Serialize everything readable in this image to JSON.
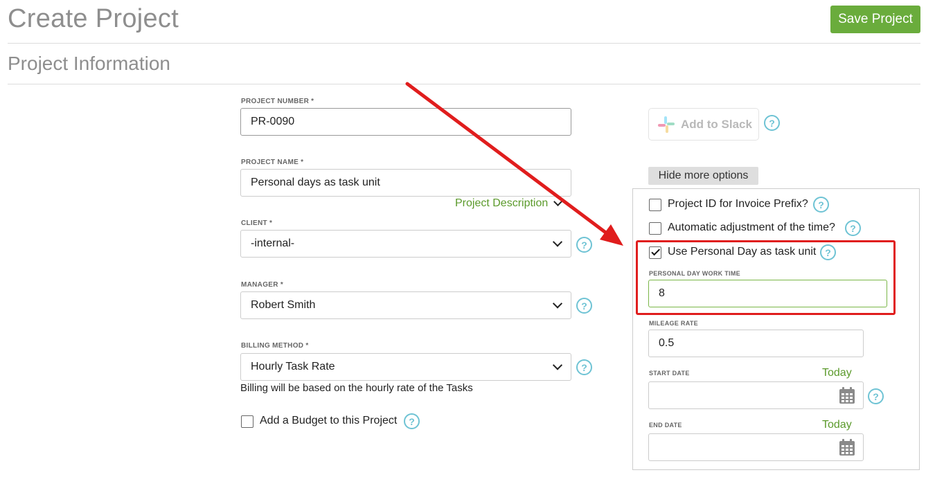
{
  "header": {
    "title": "Create Project",
    "save_label": "Save Project"
  },
  "section": {
    "title": "Project Information"
  },
  "form": {
    "project_number": {
      "label": "PROJECT NUMBER *",
      "value": "PR-0090"
    },
    "project_name": {
      "label": "PROJECT NAME *",
      "value": "Personal days as task unit"
    },
    "project_description_link": "Project Description",
    "client": {
      "label": "CLIENT *",
      "value": "-internal-"
    },
    "manager": {
      "label": "MANAGER *",
      "value": "Robert Smith"
    },
    "billing_method": {
      "label": "BILLING METHOD *",
      "value": "Hourly Task Rate",
      "help_text": "Billing will be based on the hourly rate of the Tasks"
    },
    "add_budget": {
      "label": "Add a Budget to this Project",
      "checked": false
    }
  },
  "sidebar": {
    "slack_label": "Add to Slack",
    "hide_options_label": "Hide more options",
    "options": {
      "invoice_prefix": {
        "label": "Project ID for Invoice Prefix?",
        "checked": false
      },
      "auto_adjust": {
        "label": "Automatic adjustment of the time?",
        "checked": false
      },
      "personal_day": {
        "label": "Use Personal Day as task unit",
        "checked": true
      },
      "personal_day_work_time": {
        "label": "PERSONAL DAY WORK TIME",
        "value": "8"
      },
      "mileage_rate": {
        "label": "MILEAGE RATE",
        "value": "0.5"
      },
      "start_date": {
        "label": "START DATE",
        "today_link": "Today",
        "value": ""
      },
      "end_date": {
        "label": "END DATE",
        "today_link": "Today",
        "value": ""
      }
    }
  },
  "help_glyph": "?",
  "colors": {
    "accent_green": "#6aac3c",
    "help_blue": "#6ec3d4",
    "annotation_red": "#e01d1d"
  },
  "icons": [
    "help-icon",
    "calendar-icon",
    "chevron-down-icon",
    "slack-logo-icon",
    "checkmark-icon",
    "annotation-arrow-icon"
  ]
}
